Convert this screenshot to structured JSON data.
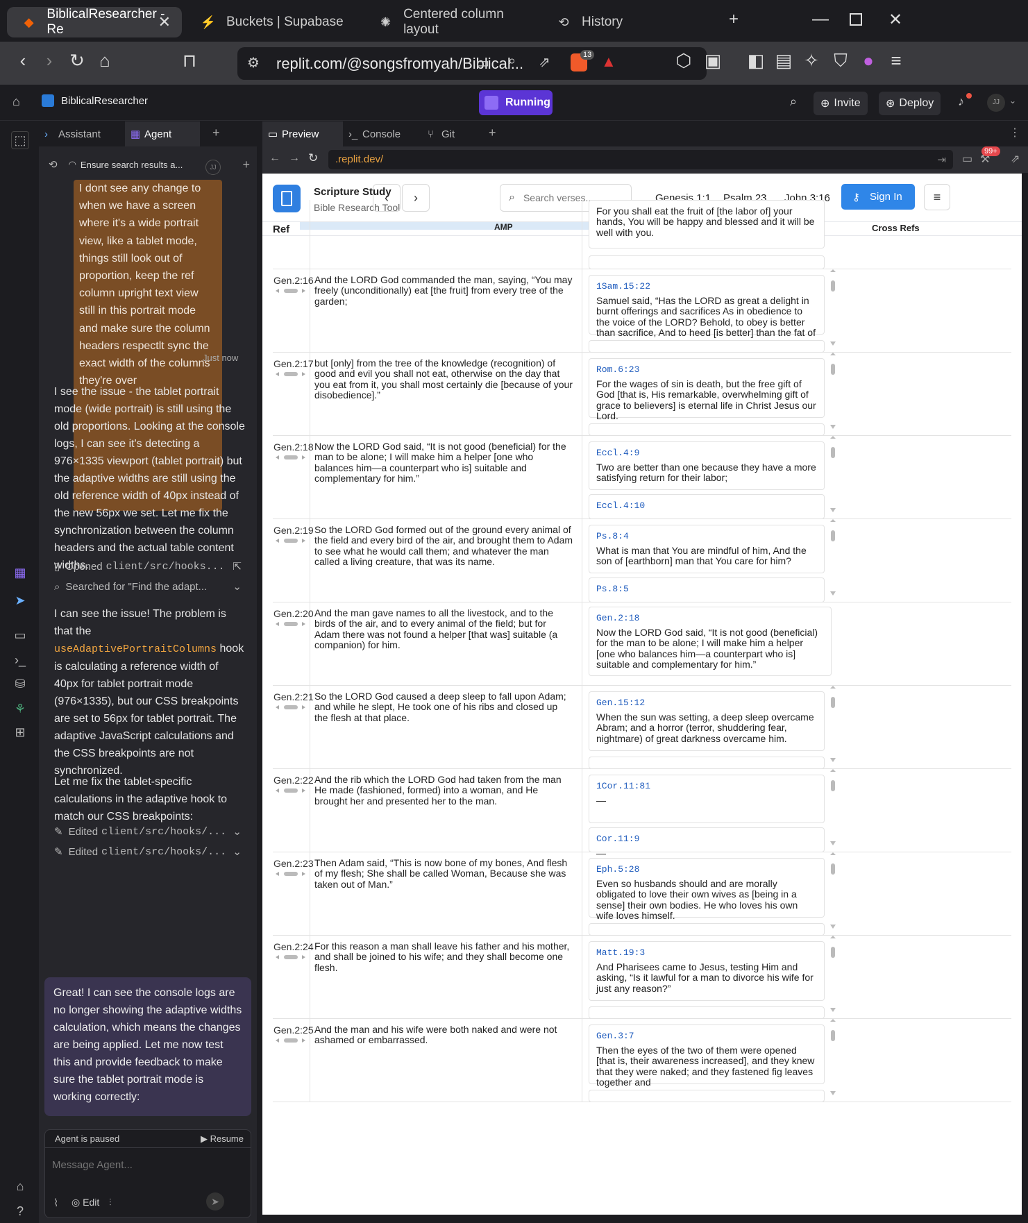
{
  "browser": {
    "tabs": [
      {
        "label": "BiblicalResearcher - Re",
        "active": true
      },
      {
        "label": "Buckets | Supabase"
      },
      {
        "label": "Centered column layout"
      },
      {
        "label": "History"
      }
    ],
    "url": "replit.com/@songsfromyah/Biblical...",
    "brave_badge": "13"
  },
  "replit": {
    "project_name": "BiblicalResearcher",
    "run_state": "Running",
    "invite_label": "Invite",
    "deploy_label": "Deploy",
    "avatar_initials": "JJ"
  },
  "agent_panel": {
    "tabs": [
      "Assistant",
      "Agent"
    ],
    "thread_title": "Ensure search results a...",
    "user_message": "I dont see any change to when we have a screen where it's a wide portrait view, like a tablet mode, things still look out of proportion, keep the ref column upright text view still in this portrait mode and make sure the column headers respectlt sync the exact width of the columns they're over",
    "user_time": "Just now",
    "msg1": "I see the issue - the tablet portrait mode (wide portrait) is still using the old proportions. Looking at the console logs, I can see it's detecting a 976×1335 viewport (tablet portrait) but the adaptive widths are still using the old reference width of 40px instead of the new 56px we set. Let me fix the synchronization between the column headers and the actual table content widths.",
    "action1_verb": "Opened",
    "action1_path": "client/src/hooks...",
    "action2": "Searched for \"Find the adapt...",
    "msg2a": "I can see the issue! The problem is that the",
    "msg2_code": "useAdaptivePortraitColumns",
    "msg2b": "hook is calculating a reference width of 40px for tablet portrait mode (976×1335), but our CSS breakpoints are set to 56px for tablet portrait. The adaptive JavaScript calculations and the CSS breakpoints are not synchronized.",
    "msg3": "Let me fix the tablet-specific calculations in the adaptive hook to match our CSS breakpoints:",
    "edit_verb": "Edited",
    "edit_path": "client/src/hooks/...",
    "final_msg": "Great! I can see the console logs are no longer showing the adaptive widths calculation, which means the changes are being applied. Let me now test this and provide feedback to make sure the tablet portrait mode is working correctly:",
    "paused_label": "Agent is paused",
    "resume_label": "Resume",
    "composer_placeholder": "Message Agent...",
    "edit_btn": "Edit"
  },
  "workspace": {
    "tabs": [
      "Preview",
      "Console",
      "Git"
    ],
    "preview_url": ".replit.dev/",
    "notif_badge": "99+"
  },
  "app": {
    "brand": "Scripture Study",
    "brand_sub": "Bible Research Tool",
    "search_placeholder": "Search verses...",
    "quick_links": [
      "Genesis 1:1",
      "Psalm 23",
      "John 3:16"
    ],
    "sign_in": "Sign In",
    "col_ref": "Ref",
    "col_amp": "AMP",
    "col_cross": "Cross Refs",
    "top_card_text": "For you shall eat the fruit of [the labor of] your hands, You will be happy and blessed and it will be well with you.",
    "rows": [
      {
        "ref": "Gen.2:16",
        "text": "And the LORD God commanded the man, saying, “You may freely (unconditionally) eat [the fruit] from every tree of the garden;",
        "xref": "1Sam.15:22",
        "xtext": "Samuel said, “Has the LORD as great a delight in burnt offerings and sacrifices As in obedience to the voice of the LORD? Behold, to obey is better than sacrifice, And to heed [is better] than the fat of rams."
      },
      {
        "ref": "Gen.2:17",
        "text": "but [only] from the tree of the knowledge (recognition) of good and evil you shall not eat, otherwise on the day that you eat from it, you shall most certainly die [because of your disobedience].”",
        "xref": "Rom.6:23",
        "xtext": "For the wages of sin is death, but the free gift of God [that is, His remarkable, overwhelming gift of grace to believers] is eternal life in Christ Jesus our Lord."
      },
      {
        "ref": "Gen.2:18",
        "text": "Now the LORD God said, “It is not good (beneficial) for the man to be alone; I will make him a helper [one who balances him—a counterpart who is] suitable and complementary for him.”",
        "xref": "Eccl.4:9",
        "xtext": "Two are better than one because they have a more satisfying return for their labor;",
        "xref2": "Eccl.4:10"
      },
      {
        "ref": "Gen.2:19",
        "text": "So the LORD God formed out of the ground every animal of the field and every bird of the air, and brought them to Adam to see what he would call them; and whatever the man called a living creature, that was its name.",
        "xref": "Ps.8:4",
        "xtext": "What is man that You are mindful of him, And the son of [earthborn] man that You care for him?",
        "xref2": "Ps.8:5"
      },
      {
        "ref": "Gen.2:20",
        "text": "And the man gave names to all the livestock, and to the birds of the air, and to every animal of the field; but for Adam there was not found a helper [that was] suitable (a companion) for him.",
        "xref": "Gen.2:18",
        "xtext": "Now the LORD God said, “It is not good (beneficial) for the man to be alone; I will make him a helper [one who balances him—a counterpart who is] suitable and complementary for him.”"
      },
      {
        "ref": "Gen.2:21",
        "text": "So the LORD God caused a deep sleep to fall upon Adam; and while he slept, He took one of his ribs and closed up the flesh at that place.",
        "xref": "Gen.15:12",
        "xtext": "When the sun was setting, a deep sleep overcame Abram; and a horror (terror, shuddering fear, nightmare) of great darkness overcame him."
      },
      {
        "ref": "Gen.2:22",
        "text": "And the rib which the LORD God had taken from the man He made (fashioned, formed) into a woman, and He brought her and presented her to the man.",
        "xref": "1Cor.11:81",
        "xtext": "—",
        "xref2": "Cor.11:9",
        "xtext2": "—"
      },
      {
        "ref": "Gen.2:23",
        "text": "Then Adam said, “This is now bone of my bones, And flesh of my flesh; She shall be called Woman, Because she was taken out of Man.”",
        "xref": "Eph.5:28",
        "xtext": "Even so husbands should and are morally obligated to love their own wives as [being in a sense] their own bodies. He who loves his own wife loves himself."
      },
      {
        "ref": "Gen.2:24",
        "text": "For this reason a man shall leave his father and his mother, and shall be joined to his wife; and they shall become one flesh.",
        "xref": "Matt.19:3",
        "xtext": "And Pharisees came to Jesus, testing Him and asking, “Is it lawful for a man to divorce his wife for just any reason?”"
      },
      {
        "ref": "Gen.2:25",
        "text": "And the man and his wife were both naked and were not ashamed or embarrassed.",
        "xref": "Gen.3:7",
        "xtext": "Then the eyes of the two of them were opened [that is, their awareness increased], and they knew that they were naked; and they fastened fig leaves together and"
      }
    ]
  }
}
